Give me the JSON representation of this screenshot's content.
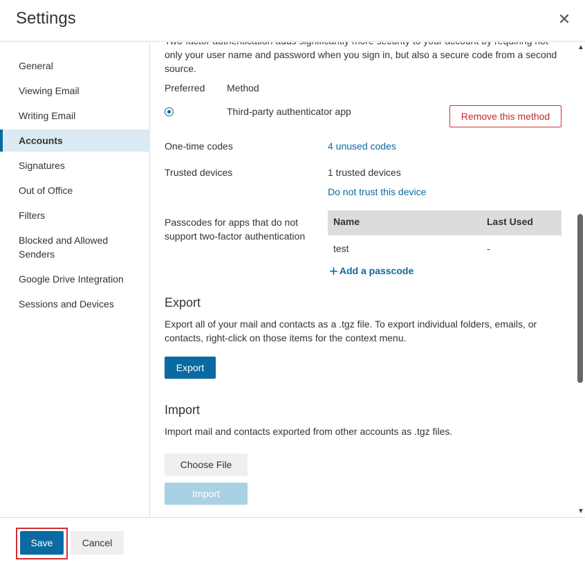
{
  "dialog": {
    "title": "Settings",
    "close_icon": "close-icon"
  },
  "sidebar": {
    "items": [
      {
        "label": "General"
      },
      {
        "label": "Viewing Email"
      },
      {
        "label": "Writing Email"
      },
      {
        "label": "Accounts",
        "active": true
      },
      {
        "label": "Signatures"
      },
      {
        "label": "Out of Office"
      },
      {
        "label": "Filters"
      },
      {
        "label": "Blocked and Allowed Senders"
      },
      {
        "label": "Google Drive Integration"
      },
      {
        "label": "Sessions and Devices"
      }
    ]
  },
  "two_factor": {
    "intro_text": "Two-factor authentication adds significantly more security to your account by requiring not only your user name and password when you sign in, but also a secure code from a second source.",
    "preferred_header": "Preferred",
    "method_header": "Method",
    "method_name": "Third-party authenticator app",
    "remove_label": "Remove this method",
    "one_time_codes_label": "One-time codes",
    "one_time_codes_link": "4 unused codes",
    "trusted_devices_label": "Trusted devices",
    "trusted_devices_value": "1 trusted devices",
    "do_not_trust_link": "Do not trust this device",
    "passcodes_label": "Passcodes for apps that do not support two-factor authentication",
    "table_headers": {
      "name": "Name",
      "last_used": "Last Used"
    },
    "passcode_rows": [
      {
        "name": "test",
        "last_used": "-"
      }
    ],
    "add_passcode_label": "Add a passcode"
  },
  "export": {
    "title": "Export",
    "description": "Export all of your mail and contacts as a .tgz file. To export individual folders, emails, or contacts, right-click on those items for the context menu.",
    "button_label": "Export"
  },
  "import": {
    "title": "Import",
    "description": "Import mail and contacts exported from other accounts as .tgz files.",
    "choose_file_label": "Choose File",
    "import_label": "Import"
  },
  "footer": {
    "save_label": "Save",
    "cancel_label": "Cancel"
  },
  "colors": {
    "accent": "#0a6aa1",
    "danger": "#d0312d",
    "active_bg": "#dceaf3"
  }
}
